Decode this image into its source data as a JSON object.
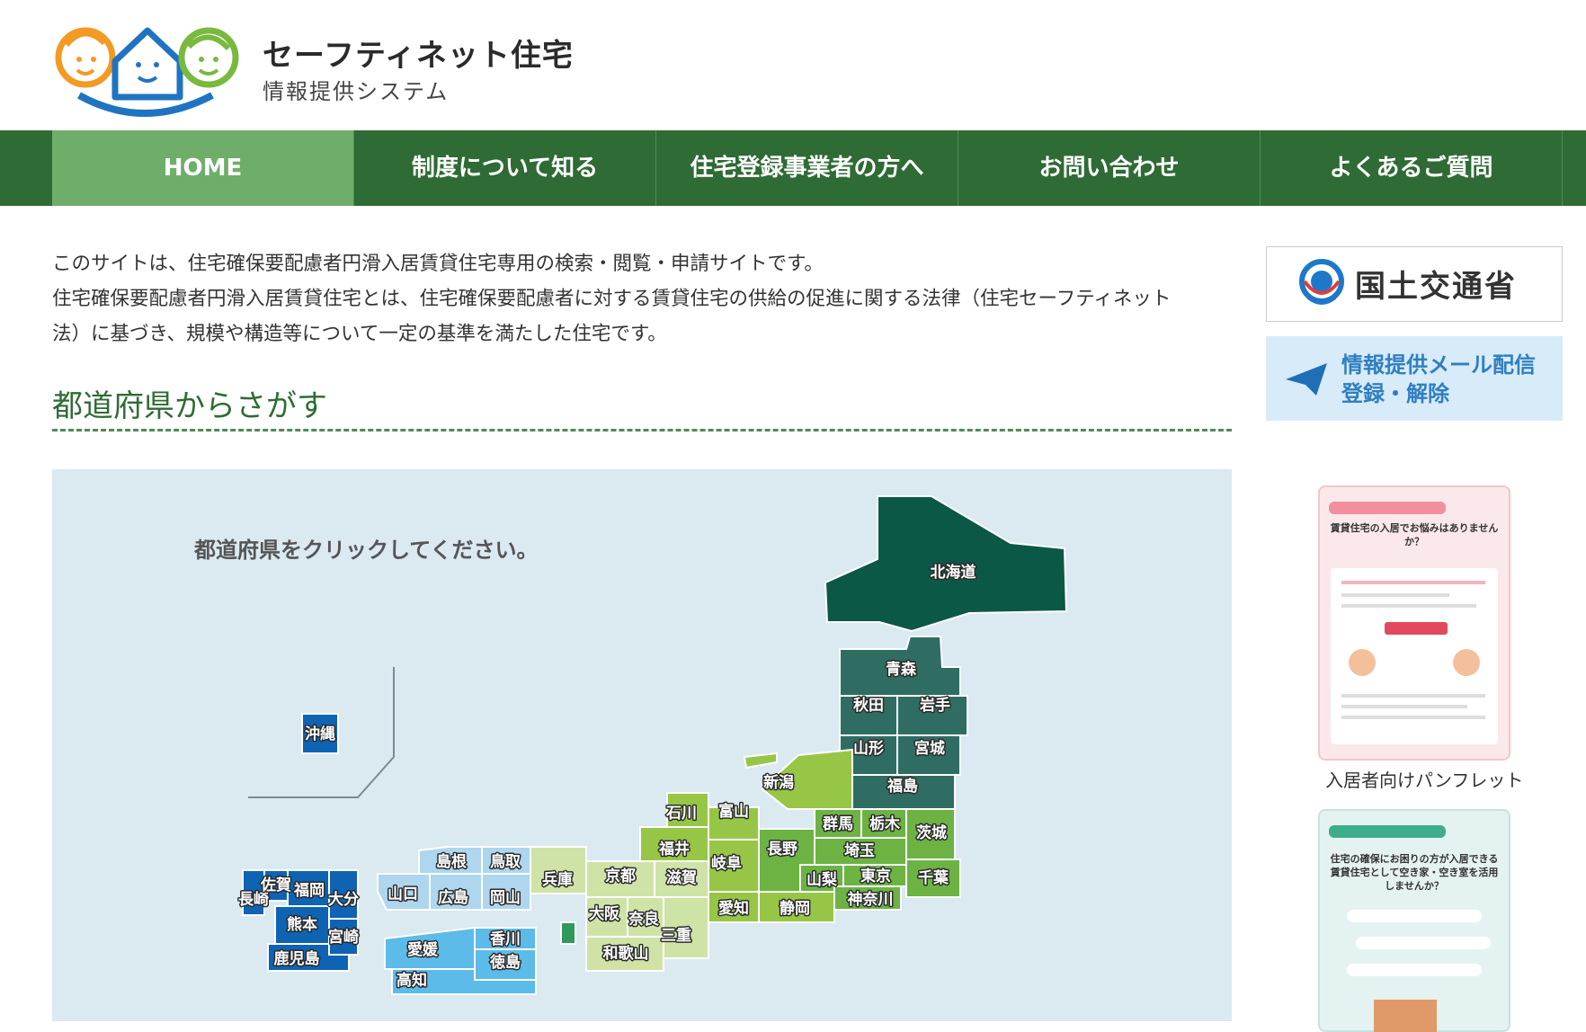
{
  "header": {
    "site_title": "セーフティネット住宅",
    "site_subtitle": "情報提供システム"
  },
  "nav": {
    "items": [
      {
        "label": "HOME"
      },
      {
        "label": "制度について知る"
      },
      {
        "label": "住宅登録事業者の方へ"
      },
      {
        "label": "お問い合わせ"
      },
      {
        "label": "よくあるご質問"
      }
    ]
  },
  "intro": {
    "line1": "このサイトは、住宅確保要配慮者円滑入居賃貸住宅専用の検索・閲覧・申請サイトです。",
    "line2": "住宅確保要配慮者円滑入居賃貸住宅とは、住宅確保要配慮者に対する賃貸住宅の供給の促進に関する法律（住宅セーフティネット",
    "line3": "法）に基づき、規模や構造等について一定の基準を満たした住宅です。"
  },
  "section": {
    "title": "都道府県からさがす"
  },
  "map": {
    "instruction": "都道府県をクリックしてください。",
    "prefectures": {
      "hokkaido": "北海道",
      "aomori": "青森",
      "akita": "秋田",
      "iwate": "岩手",
      "yamagata": "山形",
      "miyagi": "宮城",
      "fukushima": "福島",
      "niigata": "新潟",
      "ishikawa": "石川",
      "toyama": "富山",
      "gunma": "群馬",
      "tochigi": "栃木",
      "ibaraki": "茨城",
      "fukui": "福井",
      "nagano": "長野",
      "saitama": "埼玉",
      "gifu": "岐阜",
      "yamanashi": "山梨",
      "tokyo": "東京",
      "chiba": "千葉",
      "kanagawa": "神奈川",
      "kyoto": "京都",
      "shiga": "滋賀",
      "aichi": "愛知",
      "shizuoka": "静岡",
      "hyogo": "兵庫",
      "osaka": "大阪",
      "nara": "奈良",
      "mie": "三重",
      "wakayama": "和歌山",
      "shimane": "島根",
      "tottori": "鳥取",
      "yamaguchi": "山口",
      "hiroshima": "広島",
      "okayama": "岡山",
      "kagawa": "香川",
      "ehime": "愛媛",
      "tokushima": "徳島",
      "kochi": "高知",
      "okinawa": "沖縄",
      "saga": "佐賀",
      "fukuoka": "福岡",
      "nagasaki": "長崎",
      "oita": "大分",
      "kumamoto": "熊本",
      "miyazaki": "宮崎",
      "kagoshima": "鹿児島"
    },
    "region_colors": {
      "hokkaido": "#0b5847",
      "tohoku": "#2f6d62",
      "kanto": "#6cb343",
      "chubu": "#97c646",
      "kinki": "#cfe3a7",
      "chugoku": "#aed6ee",
      "shikoku": "#5cbbe8",
      "kyushu": "#0f63b3"
    }
  },
  "sidebar": {
    "mlit_label": "国土交通省",
    "mail_line1": "情報提供メール配信",
    "mail_line2": "登録・解除",
    "pamphlet1_caption": "入居者向けパンフレット",
    "pamphlet1_heading": "賃貸住宅の入居でお悩みはありませんか？",
    "pamphlet2_heading": "住宅の確保にお困りの方が入居できる賃貸住宅として空き家・空き室を活用しませんか？"
  }
}
